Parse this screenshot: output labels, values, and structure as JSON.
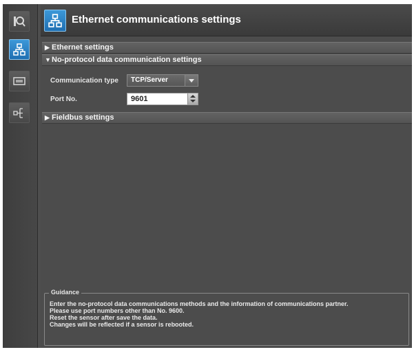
{
  "sidebar": {
    "items": [
      {
        "icon": "camera-icon",
        "active": false
      },
      {
        "icon": "network-icon",
        "active": true
      },
      {
        "icon": "display-icon",
        "active": false
      },
      {
        "icon": "io-icon",
        "active": false
      }
    ]
  },
  "header": {
    "icon": "network-icon",
    "title": "Ethernet communications settings"
  },
  "sections": {
    "ethernet": {
      "arrow": "▶",
      "label": "Ethernet settings"
    },
    "no_protocol": {
      "arrow": "▼",
      "label": "No-protocol data communication settings"
    },
    "fieldbus": {
      "arrow": "▶",
      "label": "Fieldbus settings"
    }
  },
  "form": {
    "communication_type_label": "Communication type",
    "communication_type_value": "TCP/Server",
    "port_label": "Port No.",
    "port_value": "9601"
  },
  "guidance": {
    "title": "Guidance",
    "lines": [
      "Enter the no-protocol data communications methods and the information of communications partner.",
      "Please use port numbers other than No. 9600.",
      "Reset the sensor after save the data.",
      "Changes will be reflected if a sensor is rebooted."
    ]
  },
  "colors": {
    "accent": "#2a84c8",
    "panel": "#4c4c4c"
  }
}
